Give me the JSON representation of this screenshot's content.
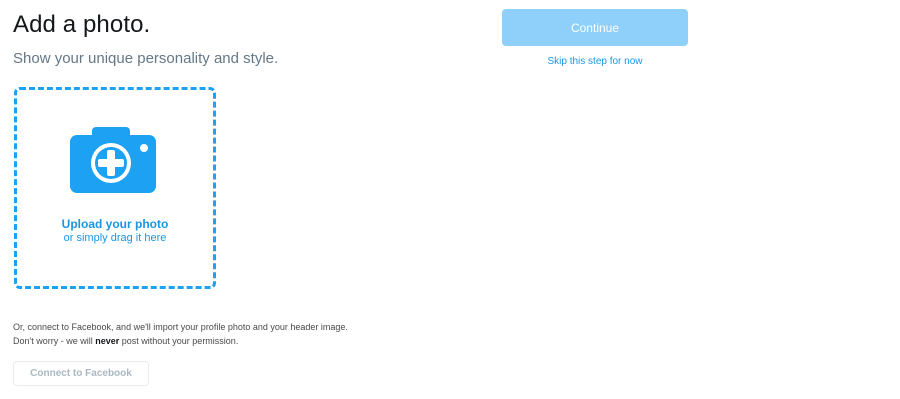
{
  "header": {
    "title": "Add a photo.",
    "subtitle": "Show your unique personality and style."
  },
  "upload": {
    "icon": "camera-plus-icon",
    "title": "Upload your photo",
    "hint": "or simply drag it here"
  },
  "facebook": {
    "line1": "Or, connect to Facebook, and we'll import your profile photo and your header image.",
    "line2_before": "Don't worry - we will ",
    "line2_emphasis": "never",
    "line2_after": " post without your permission.",
    "button_label": "Connect to Facebook"
  },
  "actions": {
    "continue_label": "Continue",
    "skip_label": "Skip this step for now"
  },
  "colors": {
    "accent": "#1da1f2",
    "continue_disabled": "#8ed0f9",
    "link": "#1b95e0"
  }
}
